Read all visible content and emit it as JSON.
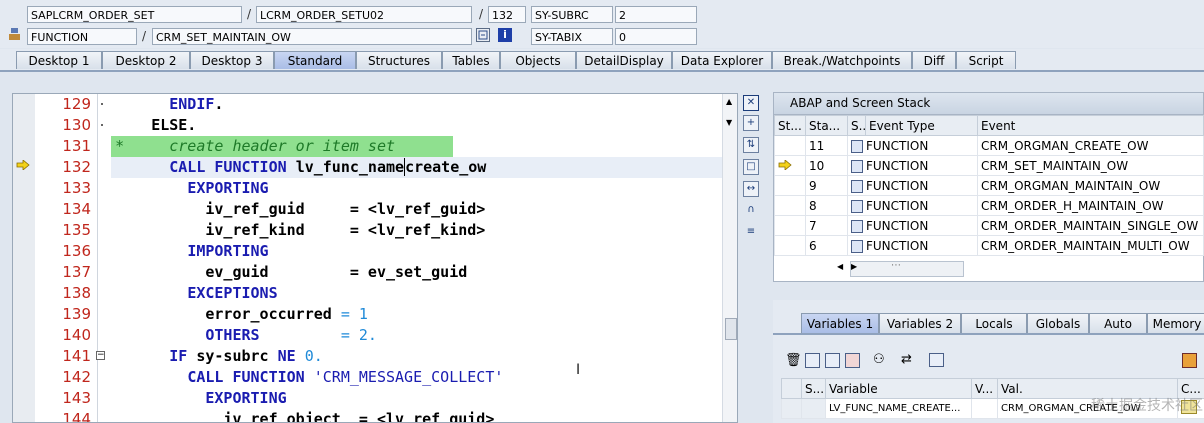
{
  "header": {
    "program": "SAPLCRM_ORDER_SET",
    "include": "LCRM_ORDER_SETU02",
    "line": "132",
    "field1_name": "SY-SUBRC",
    "field1_value": "2",
    "event_type": "FUNCTION",
    "event": "CRM_SET_MAINTAIN_OW",
    "field2_name": "SY-TABIX",
    "field2_value": "0"
  },
  "tabs": [
    "Desktop 1",
    "Desktop 2",
    "Desktop 3",
    "Standard",
    "Structures",
    "Tables",
    "Objects",
    "DetailDisplay",
    "Data Explorer",
    "Break./Watchpoints",
    "Diff",
    "Script"
  ],
  "active_tab": "Standard",
  "code": {
    "line_numbers": [
      "129",
      "130",
      "131",
      "132",
      "133",
      "134",
      "135",
      "136",
      "137",
      "138",
      "139",
      "140",
      "141",
      "142",
      "143",
      "144"
    ],
    "current_line": "132"
  },
  "stack": {
    "title": "ABAP and Screen Stack",
    "columns": [
      "St...",
      "Sta...",
      "S...",
      "Event Type",
      "Event"
    ],
    "rows": [
      {
        "level": "11",
        "type": "FUNCTION",
        "event": "CRM_ORGMAN_CREATE_OW"
      },
      {
        "level": "10",
        "type": "FUNCTION",
        "event": "CRM_SET_MAINTAIN_OW"
      },
      {
        "level": "9",
        "type": "FUNCTION",
        "event": "CRM_ORGMAN_MAINTAIN_OW"
      },
      {
        "level": "8",
        "type": "FUNCTION",
        "event": "CRM_ORDER_H_MAINTAIN_OW"
      },
      {
        "level": "7",
        "type": "FUNCTION",
        "event": "CRM_ORDER_MAINTAIN_SINGLE_OW"
      },
      {
        "level": "6",
        "type": "FUNCTION",
        "event": "CRM_ORDER_MAINTAIN_MULTI_OW"
      }
    ]
  },
  "vars": {
    "tabs": [
      "Variables 1",
      "Variables 2",
      "Locals",
      "Globals",
      "Auto",
      "Memory"
    ],
    "columns": [
      "S...",
      "Variable",
      "V...",
      "Val.",
      "C..."
    ],
    "row": {
      "variable": "LV_FUNC_NAME_CREATE...",
      "value": "CRM_ORGMAN_CREATE_OW"
    }
  },
  "watermark": "稀土掘金技术社区"
}
